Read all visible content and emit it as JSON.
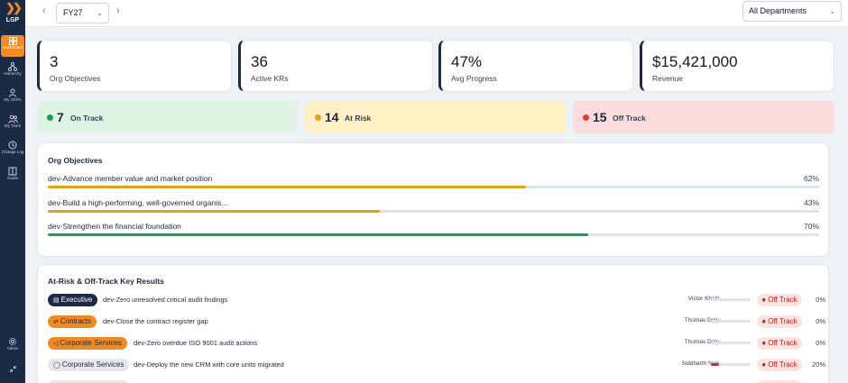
{
  "app": {
    "logo_text": "LGP"
  },
  "sidebar": {
    "items": [
      {
        "label": "Dashboard",
        "icon": "grid-icon",
        "active": true
      },
      {
        "label": "Hierarchy",
        "icon": "hierarchy-icon"
      },
      {
        "label": "My OKRs",
        "icon": "user-icon"
      },
      {
        "label": "My Team",
        "icon": "team-icon"
      },
      {
        "label": "Change Log",
        "icon": "history-icon"
      },
      {
        "label": "Guide",
        "icon": "book-icon"
      }
    ],
    "bottom": {
      "label": "Admin",
      "icon": "gear-icon"
    }
  },
  "topbar": {
    "fiscal_year": "FY27",
    "department": "All Departments"
  },
  "stats": [
    {
      "value": "3",
      "label": "Org Objectives"
    },
    {
      "value": "36",
      "label": "Active KRs"
    },
    {
      "value": "47%",
      "label": "Avg Progress"
    },
    {
      "value": "$15,421,000",
      "label": "Revenue"
    }
  ],
  "status": [
    {
      "count": "7",
      "label": "On Track",
      "bg": "#dff3e4",
      "dot": "#1f9d55"
    },
    {
      "count": "14",
      "label": "At Risk",
      "bg": "#fdf0c4",
      "dot": "#e0a21a"
    },
    {
      "count": "15",
      "label": "Off Track",
      "bg": "#fadcdc",
      "dot": "#dc3b3b"
    }
  ],
  "objectives": {
    "title": "Org Objectives",
    "items": [
      {
        "name": "dev-Advance member value and market position",
        "pct": "62%",
        "progress": 62,
        "color": "#e0a21a"
      },
      {
        "name": "dev-Build a high-performing, well-governed organis...",
        "pct": "43%",
        "progress": 43,
        "color": "#e0a21a"
      },
      {
        "name": "dev-Strengthen the financial foundation",
        "pct": "70%",
        "progress": 70,
        "color": "#1f9d55"
      }
    ]
  },
  "key_results": {
    "title": "At-Risk & Off-Track Key Results",
    "items": [
      {
        "dept": "Executive",
        "dept_icon": "document-icon",
        "dept_bg": "#1b2a45",
        "dept_fg": "#ffffff",
        "name": "dev-Zero unresolved critical audit findings",
        "owner": "Victor Khalil",
        "status": "Off Track",
        "pct": "0%",
        "progress": 0
      },
      {
        "dept": "Contracts",
        "dept_icon": "contract-icon",
        "dept_bg": "#f08a24",
        "dept_fg": "#1f2937",
        "name": "dev-Close the contract register gap",
        "owner": "Thomas Daly",
        "status": "Off Track",
        "pct": "0%",
        "progress": 0
      },
      {
        "dept": "Corporate Services",
        "dept_icon": "megaphone-icon",
        "dept_bg": "#f08a24",
        "dept_fg": "#1f2937",
        "name": "dev-Zero overdue ISO 9001 audit actions",
        "owner": "Thomas Daly",
        "status": "Off Track",
        "pct": "0%",
        "progress": 0
      },
      {
        "dept": "Corporate Services",
        "dept_icon": "user-icon",
        "dept_bg": "#e5e7eb",
        "dept_fg": "#1f2937",
        "name": "dev-Deploy the new CRM with core units migrated",
        "owner": "Siddharth Nair",
        "status": "Off Track",
        "pct": "20%",
        "progress": 20
      }
    ]
  }
}
